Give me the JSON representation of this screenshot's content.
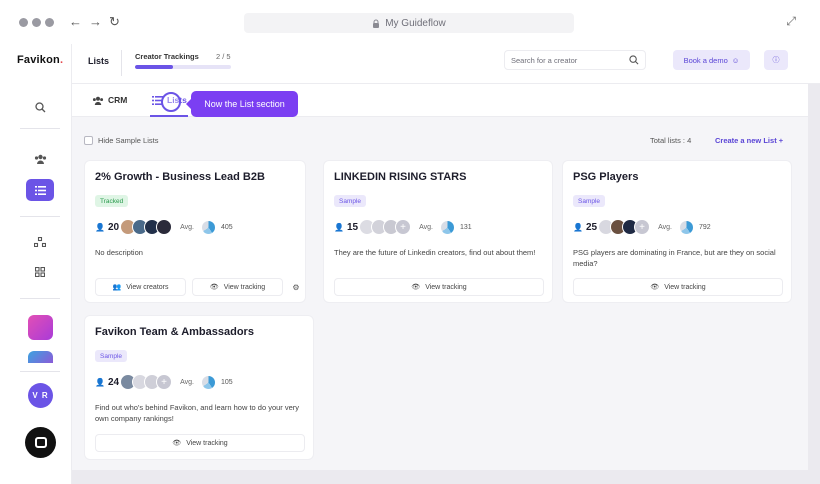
{
  "browser": {
    "url_title": "My Guideflow"
  },
  "sidebar": {
    "logo": "Favikon",
    "avatar_initials": "V R"
  },
  "topbar": {
    "section_title": "Lists",
    "tracking_label": "Creator Trackings",
    "tracking_count": "2 / 5",
    "tracking_progress": 0.4,
    "search_placeholder": "Search for a creator",
    "book_demo": "Book a demo"
  },
  "tabs": [
    {
      "label": "CRM"
    },
    {
      "label": "Lists"
    }
  ],
  "tooltip": "Now the List section",
  "toolbar": {
    "hide_samples": "Hide Sample Lists",
    "total_lists": "Total lists : 4",
    "create_list": "Create a new List"
  },
  "common": {
    "avg_label": "Avg.",
    "view_creators": "View creators",
    "view_tracking": "View tracking"
  },
  "cards": [
    {
      "title": "2% Growth - Business Lead B2B",
      "badge": "Tracked",
      "count": "20",
      "avg": "405",
      "description": "No description",
      "avatar_colors": [
        "#c49a7a",
        "#4a6a8a",
        "#22304a",
        "#2a2a3a"
      ]
    },
    {
      "title": "LINKEDIN RISING STARS",
      "badge": "Sample",
      "count": "15",
      "avg": "131",
      "description": "They are the future of Linkedin creators, find out about them!"
    },
    {
      "title": "PSG Players",
      "badge": "Sample",
      "count": "25",
      "avg": "792",
      "description": "PSG players are dominating in France, but are they on social media?",
      "avatar_colors": [
        "#d8d8e0",
        "#6a5040",
        "#1f2a44"
      ]
    },
    {
      "title": "Favikon Team & Ambassadors",
      "badge": "Sample",
      "count": "24",
      "avg": "105",
      "description": "Find out who's behind Favikon, and learn how to do your very own company rankings!",
      "avatar_colors": [
        "#7a8aa0"
      ]
    }
  ],
  "colors": {
    "accent": "#6b54e6",
    "tooltip": "#7b3ff2",
    "tracked": "#2a9a4d"
  }
}
